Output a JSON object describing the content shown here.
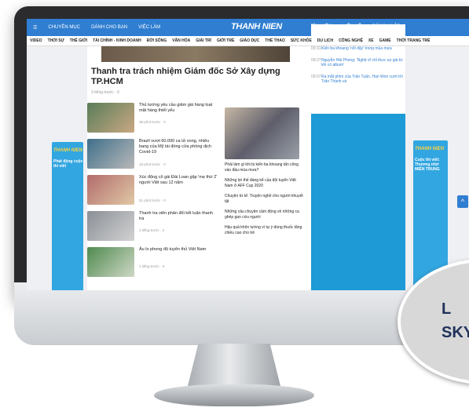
{
  "topbar": {
    "left_items": [
      "CHUYÊN MỤC",
      "DÀNH CHO BẠN",
      "VIỆC LÀM"
    ],
    "brand": "THANH NIEN",
    "right_items": [
      "TÌM KIẾM",
      "LIÊN HỆ",
      "ĐĂNG NHẬP"
    ]
  },
  "menu": {
    "items": [
      "VIDEO",
      "THỜI SỰ",
      "THẾ GIỚI",
      "TÀI CHÍNH - KINH DOANH",
      "ĐỜI SỐNG",
      "VĂN HÓA",
      "GIẢI TRÍ",
      "GIỚI TRẺ",
      "GIÁO DỤC",
      "THỂ THAO",
      "SỨC KHỎE",
      "DU LỊCH",
      "CÔNG NGHỆ",
      "XE",
      "GAME",
      "THỜI TRANG TRẺ"
    ]
  },
  "hero": {
    "title": "Thanh tra trách nhiệm Giám đốc Sở Xây dựng TP.HCM",
    "meta": "3 tiếng trước · 0"
  },
  "news": [
    {
      "title": "Thủ tướng yêu cầu giảm giá hàng loạt mặt hàng thiết yếu",
      "meta": "38 phút trước · 0"
    },
    {
      "title": "Brazil vượt 60.000 ca tử vong, nhiều bang của Mỹ tái đóng cửa phòng dịch Covid-19",
      "meta": "18 phút trước · 0"
    },
    {
      "title": "Xúc động cô gái Đài Loan gặp 'mẹ thứ 2' người Việt sau 12 năm",
      "meta": "51 phút trước · 0"
    },
    {
      "title": "Thanh tra viên phản đối kết luận thanh tra",
      "meta": "1 tiếng trước · 2"
    },
    {
      "title": "Âu lo phong độ tuyển thủ Việt Nam",
      "meta": "1 tiếng trước · 0"
    }
  ],
  "mid": {
    "items": [
      "Phải làm gì khi bị kiến ba khoang tấn công vào đầu mùa mưa?",
      "Những lợi thế đáng kể của đội tuyển Việt Nam ở AFF Cup 2020",
      "Chuyện từ tế: Truyện nghề cho người khuyết tật",
      "Những câu chuyện cảm động về những ca ghép gan cứu người",
      "Hậu quả khôn lường vì tự ý dùng thuốc tăng chiều cao cho trẻ"
    ]
  },
  "timeline": [
    {
      "time": "09:31",
      "text": "Kiến ba khoang 'nổi dậy' trong mùa mưa"
    },
    {
      "time": "09:27",
      "text": "Nguyễn Hải Phong: 'Nghệ sĩ chỉ thực sự già từ khi có album'"
    },
    {
      "time": "09:07",
      "text": "Ra mắt phim của Trấn Tuấn, Han Won cưới lời Trấn Thành và"
    }
  ],
  "ads": {
    "left_title": "THANH NIEN",
    "left_sub": "Phát động cuộc thi viết",
    "right_title": "THANH NIEN",
    "right_sub": "Cuộc thi viết: Thương nhớ MIỀN TRUNG"
  },
  "bubble": {
    "text": "L\nSKY"
  }
}
